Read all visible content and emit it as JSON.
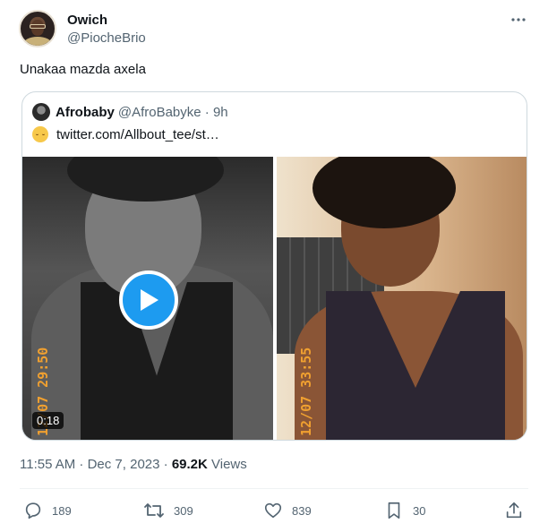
{
  "tweet": {
    "author": {
      "display_name": "Owich",
      "handle": "@PiocheBrio"
    },
    "text": "Unakaa mazda axela",
    "timestamp": "11:55 AM · Dec 7, 2023 · ",
    "views_count": "69.2K",
    "views_label": " Views"
  },
  "quoted": {
    "name": "Afrobaby",
    "handle": "@AfroBabyke · 9h",
    "text": "twitter.com/Allbout_tee/st…",
    "video_duration": "0:18",
    "left_stamp": "12/07 29:50",
    "right_stamp": "12/07 33:55"
  },
  "actions": {
    "replies": "189",
    "reposts": "309",
    "likes": "839",
    "bookmarks": "30"
  },
  "colors": {
    "accent": "#1d9bf0",
    "muted": "#536471",
    "text": "#0f1419"
  },
  "icons": [
    "more-icon",
    "play-icon",
    "reply-icon",
    "repost-icon",
    "like-icon",
    "bookmark-icon",
    "share-icon"
  ]
}
